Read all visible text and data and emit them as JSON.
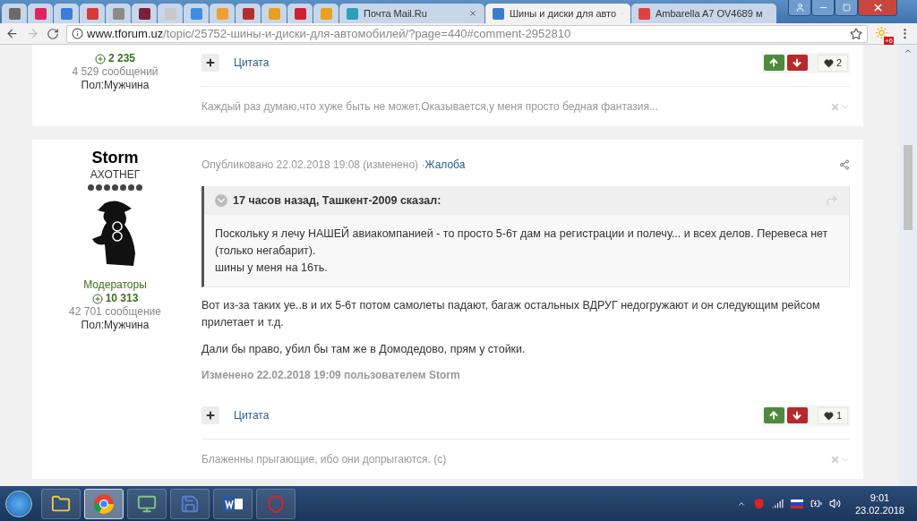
{
  "browser": {
    "tabs": [
      {
        "kind": "icon",
        "color": "#6b6b6b",
        "selected": false
      },
      {
        "kind": "icon",
        "color": "#e0245e",
        "selected": false
      },
      {
        "kind": "icon",
        "color": "#3b7dd8",
        "selected": false
      },
      {
        "kind": "icon",
        "color": "#d63a3a",
        "selected": false
      },
      {
        "kind": "icon",
        "color": "#8a8a8a",
        "selected": false
      },
      {
        "kind": "icon",
        "color": "#7a1f3d",
        "selected": false
      },
      {
        "kind": "icon",
        "color": "#c8c8c8",
        "selected": false
      },
      {
        "kind": "icon",
        "color": "#3b8ee6",
        "selected": false
      },
      {
        "kind": "icon",
        "color": "#f0a030",
        "selected": false
      },
      {
        "kind": "icon",
        "color": "#b03030",
        "selected": false
      },
      {
        "kind": "icon",
        "color": "#e8a020",
        "selected": false
      },
      {
        "kind": "icon",
        "color": "#d02030",
        "selected": false
      },
      {
        "kind": "icon",
        "color": "#e8a020",
        "selected": false
      },
      {
        "kind": "page",
        "title": "Почта Mail.Ru",
        "color": "#2aa1b8",
        "selected": false
      },
      {
        "kind": "page",
        "title": "Шины и диски для авто",
        "color": "#3d7cc9",
        "selected": true
      },
      {
        "kind": "page",
        "title": "Ambarella A7 OV4689 м",
        "color": "#e04040",
        "selected": false
      }
    ],
    "address": {
      "host": "www.tforum.uz",
      "path": "/topic/25752-шины-и-диски-для-автомобилей/?page=440#comment-2952810"
    },
    "extension_badge": "+6"
  },
  "posts": [
    {
      "author": {
        "reputation": "2 235",
        "posts_count": "4 529 сообщений",
        "gender": "Пол:Мужчина"
      },
      "quote_button": "Цитата",
      "likes": "2",
      "signature": "Каждый раз думаю,что хуже быть не может.Оказывается,у меня просто бедная фантазия..."
    },
    {
      "author": {
        "name": "Storm",
        "rank": "АХОТНЕГ",
        "group": "Модераторы",
        "reputation": "10 313",
        "posts_count": "42 701 сообщение",
        "gender": "Пол:Мужчина"
      },
      "meta": "Опубликовано 22.02.2018 19:08 (изменено) · ",
      "report_link": "Жалоба",
      "quote": {
        "header": "17 часов назад, Ташкент-2009 сказал:",
        "lines": [
          "Поскольку я лечу НАШЕЙ авиакомпанией - то просто 5-6т дам на регистрации и полечу... и всех делов. Перевеса нет (только негабарит).",
          "шины у меня на 16ть."
        ]
      },
      "paragraphs": [
        "Вот из-за таких уе..в и их 5-6т потом самолеты падают, багаж остальных ВДРУГ недогружают и он следующим рейсом прилетает и т.д.",
        "Дали бы право, убил бы там же в Домодедово, прям у стойки."
      ],
      "edited_note": "Изменено 22.02.2018 19:09 пользователем Storm",
      "quote_button": "Цитата",
      "likes": "1",
      "signature": "Блаженны прыгающие, ибо они допрыгаются. (с)"
    }
  ],
  "taskbar": {
    "apps": [
      {
        "kind": "folder",
        "selected": false
      },
      {
        "kind": "browser",
        "selected": true
      },
      {
        "kind": "monitor",
        "selected": false
      },
      {
        "kind": "disk",
        "selected": false
      },
      {
        "kind": "word",
        "selected": false
      },
      {
        "kind": "shield",
        "selected": false
      }
    ],
    "clock": {
      "time": "9:01",
      "date": "23.02.2018"
    }
  }
}
